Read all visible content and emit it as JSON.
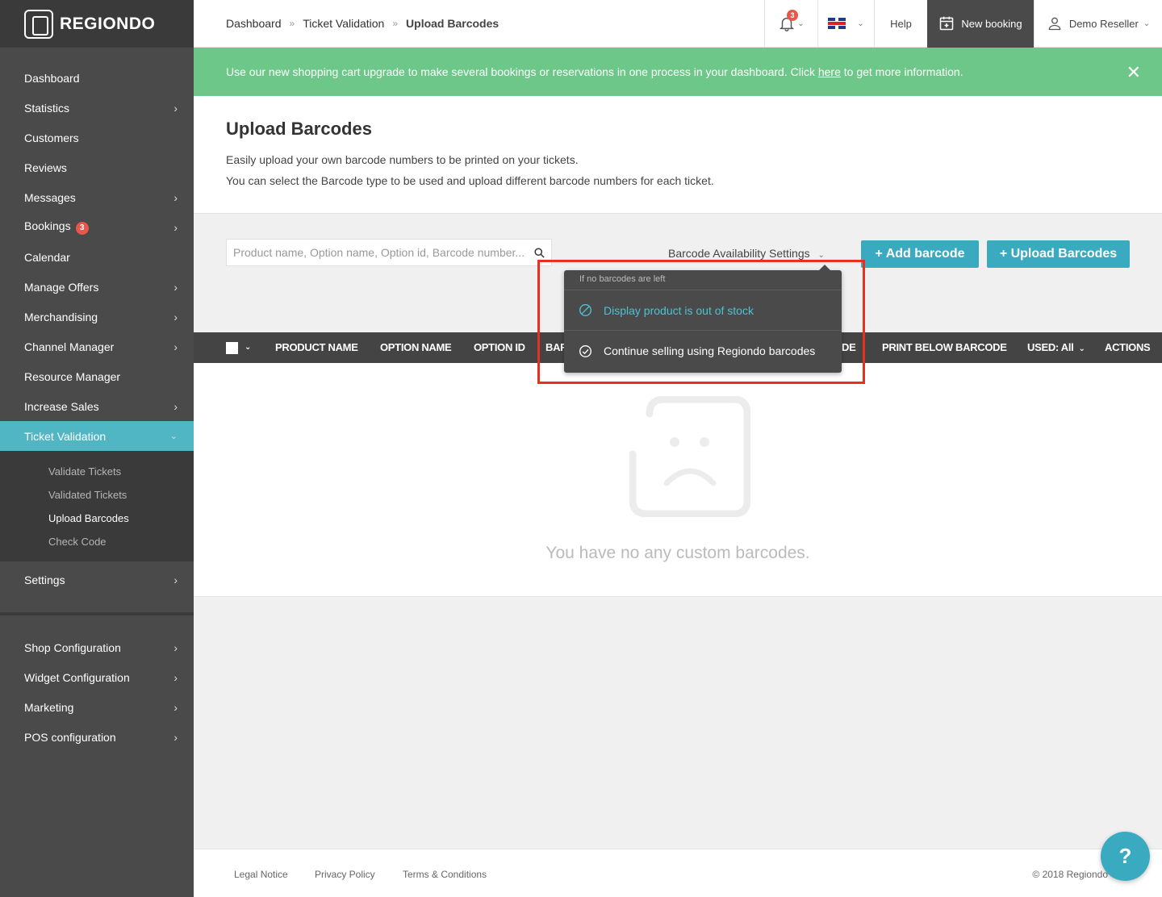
{
  "app": {
    "name": "REGIONDO"
  },
  "sidebar": {
    "items": [
      {
        "label": "Dashboard",
        "chevron": false
      },
      {
        "label": "Statistics",
        "chevron": true
      },
      {
        "label": "Customers",
        "chevron": false
      },
      {
        "label": "Reviews",
        "chevron": false
      },
      {
        "label": "Messages",
        "chevron": true
      },
      {
        "label": "Bookings",
        "chevron": true,
        "badge": "3"
      },
      {
        "label": "Calendar",
        "chevron": false
      },
      {
        "label": "Manage Offers",
        "chevron": true
      },
      {
        "label": "Merchandising",
        "chevron": true
      },
      {
        "label": "Channel Manager",
        "chevron": true
      },
      {
        "label": "Resource Manager",
        "chevron": false
      },
      {
        "label": "Increase Sales",
        "chevron": true
      },
      {
        "label": "Ticket Validation",
        "chevron": true,
        "active": true
      }
    ],
    "subitems": [
      {
        "label": "Validate Tickets"
      },
      {
        "label": "Validated Tickets"
      },
      {
        "label": "Upload Barcodes",
        "current": true
      },
      {
        "label": "Check Code"
      }
    ],
    "settings": {
      "label": "Settings"
    },
    "bottom_items": [
      {
        "label": "Shop Configuration"
      },
      {
        "label": "Widget Configuration"
      },
      {
        "label": "Marketing"
      },
      {
        "label": "POS configuration"
      }
    ]
  },
  "topbar": {
    "breadcrumb": [
      "Dashboard",
      "Ticket Validation",
      "Upload Barcodes"
    ],
    "breadcrumb_sep": "»",
    "notifications_count": "3",
    "help": "Help",
    "new_booking": "New booking",
    "user": "Demo Reseller"
  },
  "banner": {
    "text_before": "Use our new shopping cart upgrade to make several bookings or reservations in one process in your dashboard. Click ",
    "link": "here",
    "text_after": " to get more information.",
    "close": "✕",
    "color": "#6cc788"
  },
  "page": {
    "title": "Upload Barcodes",
    "desc_line1": "Easily upload your own barcode numbers to be printed on your tickets.",
    "desc_line2": "You can select the Barcode type to be used and upload different barcode numbers for each ticket."
  },
  "toolbar": {
    "search_placeholder": "Product name, Option name, Option id, Barcode number...",
    "availability_label": "Barcode Availability Settings",
    "add_barcode": "+ Add barcode",
    "upload_barcodes": "+ Upload Barcodes",
    "accent": "#3aaac0"
  },
  "table": {
    "headers": [
      "PRODUCT NAME",
      "OPTION NAME",
      "OPTION ID",
      "BAR",
      "DE",
      "PRINT BELOW BARCODE",
      "USED: All",
      "ACTIONS"
    ]
  },
  "dropdown": {
    "header": "If no barcodes are left",
    "option1": "Display product is out of stock",
    "option2": "Continue selling using Regiondo barcodes"
  },
  "empty": {
    "text": "You have no any custom barcodes."
  },
  "footer": {
    "links": [
      "Legal Notice",
      "Privacy Policy",
      "Terms & Conditions"
    ],
    "copyright": "© 2018 Regiondo"
  },
  "help_bubble": "?"
}
